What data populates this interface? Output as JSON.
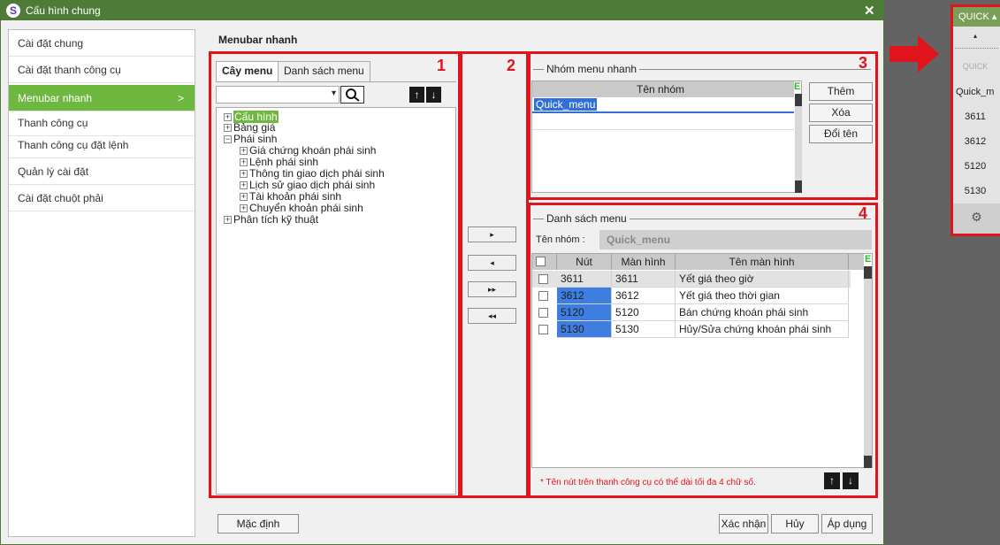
{
  "window": {
    "title": "Cấu hình chung",
    "logo_glyph": "S",
    "close_glyph": "✕"
  },
  "nav": {
    "items": [
      {
        "label": "Cài đặt chung"
      },
      {
        "label": "Cài đặt thanh công cụ"
      },
      {
        "label": "Menubar nhanh",
        "active": true,
        "chevron": ">"
      },
      {
        "label": "Thanh công cụ"
      },
      {
        "label": "Thanh công cụ đặt lệnh"
      },
      {
        "label": "Quản lý cài đặt"
      },
      {
        "label": "Cài đặt chuột phải"
      }
    ]
  },
  "content": {
    "title": "Menubar nhanh"
  },
  "annotations": {
    "box1": "1",
    "box2": "2",
    "box3": "3",
    "box4": "4"
  },
  "tree_panel": {
    "tabs": [
      "Cây menu",
      "Danh sách menu"
    ],
    "search_value": "",
    "dropdown_glyph": "▾",
    "up_glyph": "↑",
    "down_glyph": "↓",
    "nodes": [
      {
        "label": "Cấu hình",
        "expander": "+",
        "selected": true
      },
      {
        "label": "Bảng giá",
        "expander": "+"
      },
      {
        "label": "Phái sinh",
        "expander": "−"
      },
      {
        "label": "Giá chứng khoán phái sinh",
        "expander": "+",
        "child": true
      },
      {
        "label": "Lệnh phái sinh",
        "expander": "+",
        "child": true
      },
      {
        "label": "Thông tin giao dịch phái sinh",
        "expander": "+",
        "child": true
      },
      {
        "label": "Lịch sử giao dịch phái sinh",
        "expander": "+",
        "child": true
      },
      {
        "label": "Tài khoản phái sinh",
        "expander": "+",
        "child": true
      },
      {
        "label": "Chuyển khoản phái sinh",
        "expander": "+",
        "child": true
      },
      {
        "label": "Phân tích kỹ thuật",
        "expander": "+"
      }
    ]
  },
  "transfer": {
    "add_one": "▸",
    "remove_one": "◂",
    "add_all": "▸▸",
    "remove_all": "◂◂"
  },
  "group_panel": {
    "legend": "Nhóm menu nhanh",
    "column": "Tên nhóm",
    "rows": [
      "Quick_menu"
    ],
    "excel_glyph": "E",
    "buttons": {
      "add": "Thêm",
      "delete": "Xóa",
      "rename": "Đổi tên"
    }
  },
  "menu_list": {
    "legend": "Danh sách menu",
    "group_label": "Tên nhóm :",
    "group_value": "Quick_menu",
    "columns": [
      "Nút",
      "Màn hình",
      "Tên màn hình"
    ],
    "excel_glyph": "E",
    "rows": [
      {
        "nut": "3611",
        "screen": "3611",
        "name": "Yết giá theo giờ",
        "selected": true
      },
      {
        "nut": "3612",
        "screen": "3612",
        "name": "Yết giá theo thời gian"
      },
      {
        "nut": "5120",
        "screen": "5120",
        "name": "Bán chứng khoán phái sinh"
      },
      {
        "nut": "5130",
        "screen": "5130",
        "name": "Hủy/Sửa chứng khoán phái sinh"
      }
    ],
    "note": "* Tên nút trên thanh công cụ có thể dài tối đa 4 chữ số."
  },
  "footer": {
    "default": "Mặc định",
    "confirm": "Xác nhận",
    "cancel": "Hủy",
    "apply": "Áp dụng"
  },
  "quick_strip": {
    "header": "QUICK ▴",
    "collapse_glyph": "▴",
    "faded_label": "QUICK",
    "title": "Quick_m",
    "items": [
      "3611",
      "3612",
      "5120",
      "5130"
    ],
    "gear_glyph": "⚙"
  },
  "colors": {
    "accent_green": "#6fb83f",
    "title_green": "#4e7b37",
    "annotation_red": "#e1141c",
    "cell_blue": "#3d7ee0"
  }
}
